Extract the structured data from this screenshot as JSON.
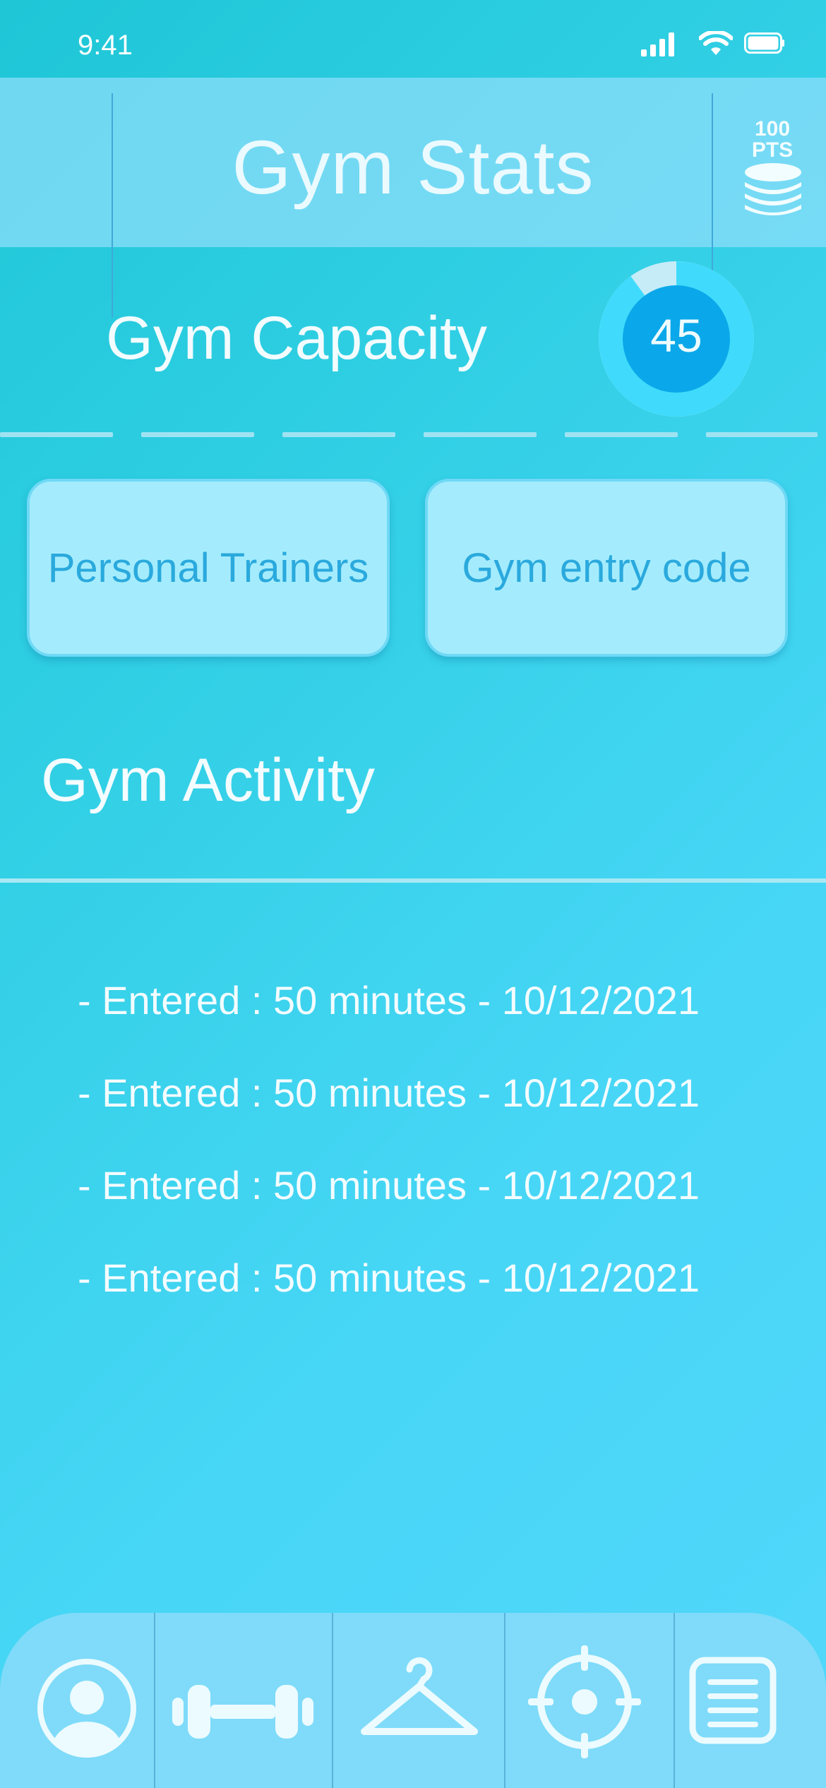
{
  "status_bar": {
    "time": "9:41"
  },
  "header": {
    "title": "Gym Stats",
    "points": "100",
    "points_unit": "PTS"
  },
  "capacity": {
    "label": "Gym Capacity",
    "value": "45",
    "fraction": 0.9
  },
  "buttons": {
    "personal_trainers": "Personal Trainers",
    "entry_code": "Gym entry code"
  },
  "activity": {
    "title": "Gym Activity",
    "entries": [
      "- Entered : 50 minutes - 10/12/2021",
      "- Entered : 50 minutes - 10/12/2021",
      "- Entered : 50 minutes - 10/12/2021",
      "- Entered : 50 minutes - 10/12/2021"
    ]
  },
  "tab_bar": {
    "icons": [
      "profile-icon",
      "dumbbell-icon",
      "hanger-icon",
      "target-icon",
      "notes-icon"
    ]
  },
  "colors": {
    "accent": "#2aa9dd",
    "gauge_fill": "#0aa8ea",
    "button_bg": "#a4ecfd"
  }
}
